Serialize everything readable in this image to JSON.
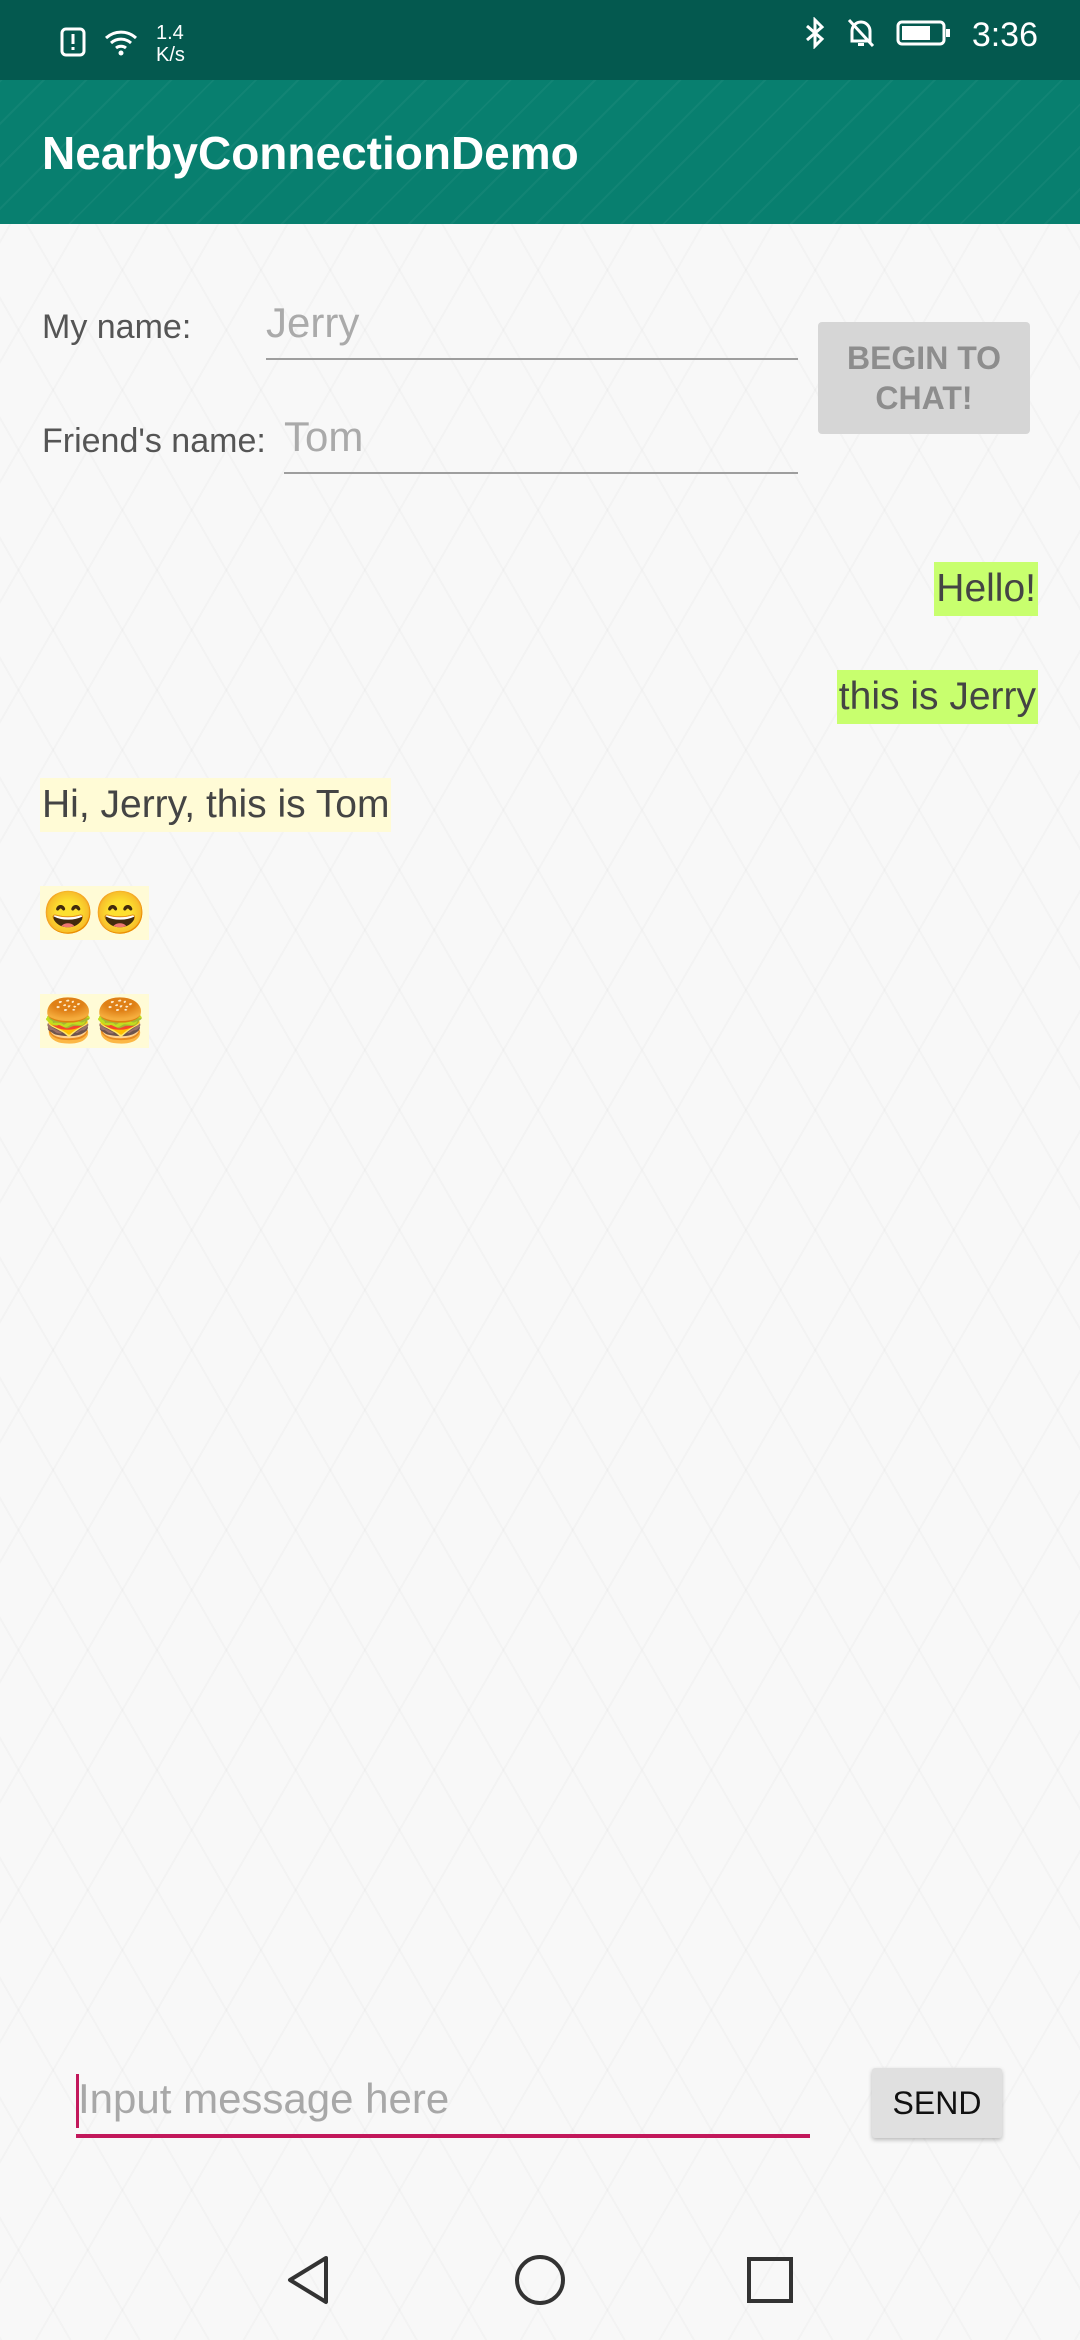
{
  "status_bar": {
    "net_speed_value": "1.4",
    "net_speed_unit": "K/s",
    "time": "3:36",
    "icons": [
      "alert-icon",
      "wifi-icon",
      "bluetooth-icon",
      "bell-off-icon",
      "battery-icon"
    ]
  },
  "app_bar": {
    "title": "NearbyConnectionDemo"
  },
  "form": {
    "my_name_label": "My name:",
    "my_name_placeholder": "Jerry",
    "friend_name_label": "Friend's name:",
    "friend_name_placeholder": "Tom",
    "begin_button_line1": "BEGIN TO",
    "begin_button_line2": "CHAT!"
  },
  "messages": [
    {
      "text": "Hello!",
      "direction": "sent"
    },
    {
      "text": "this is Jerry",
      "direction": "sent"
    },
    {
      "text": "Hi, Jerry, this is Tom",
      "direction": "received"
    },
    {
      "text": "😄😄",
      "direction": "received"
    },
    {
      "text": "🍔🍔",
      "direction": "received"
    }
  ],
  "composer": {
    "placeholder": "Input message here",
    "send_label": "SEND"
  },
  "colors": {
    "status_bar": "#04594f",
    "app_bar": "#087f6f",
    "sent_bubble": "#c8ff6e",
    "received_bubble": "#fffbd6",
    "accent": "#c2185b"
  },
  "nav_bar": {
    "icons": [
      "back-icon",
      "home-icon",
      "recents-icon"
    ]
  }
}
